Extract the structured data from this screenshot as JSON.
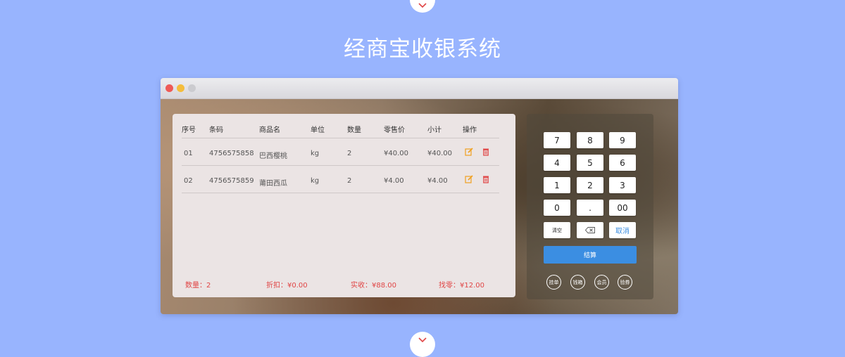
{
  "page": {
    "title": "经商宝收银系统"
  },
  "icons": {
    "scroll_up": "chevron-down-icon",
    "scroll_down": "chevron-down-icon",
    "edit": "edit-icon",
    "delete": "trash-icon",
    "backspace": "backspace-icon"
  },
  "colors": {
    "background": "#98b4fe",
    "accent": "#3b8ee2",
    "summary_text": "#e04545",
    "edit_icon": "#f0a020",
    "delete_icon": "#e04545"
  },
  "table": {
    "headers": [
      "序号",
      "条码",
      "商品名",
      "单位",
      "数量",
      "零售价",
      "小计",
      "操作"
    ],
    "rows": [
      [
        "01",
        "4756575858",
        "巴西樱桃",
        "kg",
        "2",
        "¥40.00",
        "¥40.00"
      ],
      [
        "02",
        "4756575859",
        "莆田西瓜",
        "kg",
        "2",
        "¥4.00",
        "¥4.00"
      ]
    ]
  },
  "summary": {
    "quantity": "数量：2",
    "discount": "折扣：¥0.00",
    "received": "实收：¥88.00",
    "change": "找零：¥12.00"
  },
  "keypad": {
    "keys": [
      [
        "7",
        "8",
        "9"
      ],
      [
        "4",
        "5",
        "6"
      ],
      [
        "1",
        "2",
        "3"
      ],
      [
        "0",
        ".",
        "00"
      ]
    ],
    "clear": "清空",
    "cancel": "取消",
    "checkout": "结算",
    "actions": [
      "挂单",
      "钱箱",
      "会员",
      "验券"
    ]
  }
}
